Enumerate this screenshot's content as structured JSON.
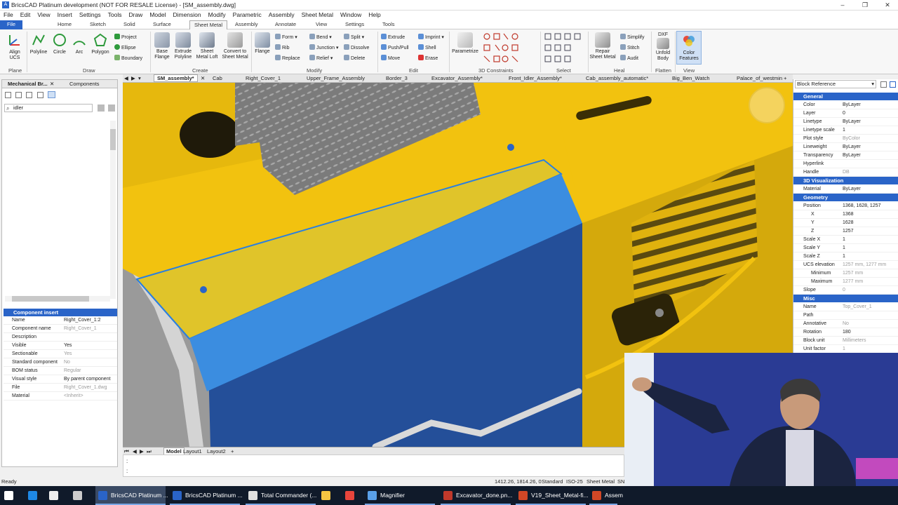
{
  "window": {
    "title": "BricsCAD Platinum development (NOT FOR RESALE License) - [SM_assembly.dwg]",
    "logo": "A"
  },
  "menu": [
    "File",
    "Edit",
    "View",
    "Insert",
    "Settings",
    "Tools",
    "Draw",
    "Model",
    "Dimension",
    "Modify",
    "Parametric",
    "Assembly",
    "Sheet Metal",
    "Window",
    "Help"
  ],
  "ribbon_tabs": [
    "File",
    "Home",
    "Sketch",
    "Solid",
    "Surface",
    "Sheet Metal",
    "Assembly",
    "Annotate",
    "View",
    "Settings",
    "Tools"
  ],
  "ribbon": {
    "plane": {
      "align_ucs": "Align UCS",
      "group": "Plane"
    },
    "draw": {
      "polyline": "Polyline",
      "circle": "Circle",
      "arc": "Arc",
      "polygon": "Polygon",
      "project": "Project",
      "ellipse": "Ellipse",
      "boundary": "Boundary",
      "group": "Draw"
    },
    "create": {
      "base_flange": "Base Flange",
      "extrude_polyline": "Extrude Polyline",
      "sheet_metal_loft": "Sheet Metal Loft",
      "convert": "Convert to Sheet Metal",
      "group": "Create"
    },
    "modify": {
      "flange": "Flange",
      "form": "Form",
      "rib": "Rib",
      "replace": "Replace",
      "bend": "Bend",
      "junction": "Junction",
      "relief": "Relief",
      "split": "Split",
      "dissolve": "Dissolve",
      "delete": "Delete",
      "group": "Modify"
    },
    "edit": {
      "extrude": "Extrude",
      "push_pull": "Push/Pull",
      "move": "Move",
      "imprint": "Imprint",
      "shell": "Shell",
      "erase": "Erase",
      "group": "Edit"
    },
    "constraints": {
      "parametrize": "Parametrize",
      "group": "3D Constraints"
    },
    "select": {
      "group": "Select"
    },
    "heal": {
      "repair": "Repair Sheet Metal",
      "simplify": "Simplify",
      "stitch": "Stitch",
      "audit": "Audit",
      "group": "Heal"
    },
    "flatten": {
      "dxf": "DXF",
      "unfold": "Unfold Body",
      "group": "Flatten"
    },
    "view": {
      "color_features": "Color Features",
      "group": "View"
    }
  },
  "doc_tabs": [
    "SM_assembly*",
    "Cab",
    "Right_Cover_1",
    "Upper_Frame_Assembly",
    "Border_3",
    "Excavator_Assembly*",
    "Front_Idler_Assembly*",
    "Cab_assembly_automatic*",
    "Big_Ben_Watch",
    "Palace_of_westmin"
  ],
  "left_panel": {
    "tabs": [
      "Mechanical Br...",
      "Components"
    ],
    "search_value": "idler",
    "section_title": "Component insert",
    "properties": [
      {
        "k": "Name",
        "v": "Right_Cover_1:2",
        "grey": false
      },
      {
        "k": "Component name",
        "v": "Right_Cover_1",
        "grey": true
      },
      {
        "k": "Description",
        "v": "",
        "grey": false
      },
      {
        "k": "Visible",
        "v": "Yes",
        "grey": false
      },
      {
        "k": "Sectionable",
        "v": "Yes",
        "grey": true
      },
      {
        "k": "Standard component",
        "v": "No",
        "grey": true
      },
      {
        "k": "BOM status",
        "v": "Regular",
        "grey": true
      },
      {
        "k": "Visual style",
        "v": "By parent component",
        "grey": false
      },
      {
        "k": "File",
        "v": "Right_Cover_1.dwg",
        "grey": true
      },
      {
        "k": "Material",
        "v": "<Inherit>",
        "grey": true
      }
    ]
  },
  "right_panel": {
    "selector": "Block Reference",
    "sections": {
      "general": "General",
      "visualization": "3D Visualization",
      "geometry": "Geometry",
      "misc": "Misc"
    },
    "general": [
      {
        "k": "Color",
        "v": "ByLayer"
      },
      {
        "k": "Layer",
        "v": "0"
      },
      {
        "k": "Linetype",
        "v": "ByLayer"
      },
      {
        "k": "Linetype scale",
        "v": "1"
      },
      {
        "k": "Plot style",
        "v": "ByColor"
      },
      {
        "k": "Lineweight",
        "v": "ByLayer"
      },
      {
        "k": "Transparency",
        "v": "ByLayer"
      },
      {
        "k": "Hyperlink",
        "v": ""
      },
      {
        "k": "Handle",
        "v": "DB"
      }
    ],
    "material": {
      "k": "Material",
      "v": "ByLayer"
    },
    "geometry": [
      {
        "k": "Position",
        "v": "1368, 1628, 1257",
        "sub": false
      },
      {
        "k": "X",
        "v": "1368",
        "sub": true
      },
      {
        "k": "Y",
        "v": "1628",
        "sub": true
      },
      {
        "k": "Z",
        "v": "1257",
        "sub": true
      },
      {
        "k": "Scale X",
        "v": "1",
        "sub": false
      },
      {
        "k": "Scale Y",
        "v": "1",
        "sub": false
      },
      {
        "k": "Scale Z",
        "v": "1",
        "sub": false
      },
      {
        "k": "UCS elevation",
        "v": "1257 mm, 1277 mm",
        "sub": false
      },
      {
        "k": "Minimum",
        "v": "1257 mm",
        "sub": true
      },
      {
        "k": "Maximum",
        "v": "1277 mm",
        "sub": true
      },
      {
        "k": "Slope",
        "v": "0",
        "sub": false
      }
    ],
    "misc": [
      {
        "k": "Name",
        "v": "Top_Cover_1"
      },
      {
        "k": "Path",
        "v": ""
      },
      {
        "k": "Annotative",
        "v": "No"
      },
      {
        "k": "Rotation",
        "v": "180"
      },
      {
        "k": "Block unit",
        "v": "Millimeters"
      },
      {
        "k": "Unit factor",
        "v": "1"
      }
    ]
  },
  "layout_tabs": [
    "Model",
    "Layout1",
    "Layout2",
    "+"
  ],
  "status": {
    "left": "Ready",
    "coords": "1412.26, 1814.26, 0",
    "standard": "Standard",
    "iso": "ISO-25",
    "workspace": "Sheet Metal",
    "sn": "SN"
  },
  "taskbar": [
    {
      "label": "",
      "color": "#ffffff",
      "icon": "windows-icon"
    },
    {
      "label": "",
      "color": "#1e88e5",
      "icon": "edge-icon"
    },
    {
      "label": "",
      "color": "#cccccc",
      "icon": "mail-icon"
    },
    {
      "label": "",
      "color": "#eeeeee",
      "icon": "calendar-icon"
    },
    {
      "label": "BricsCAD Platinum ...",
      "color": "#2a64c8",
      "icon": "bricscad-icon"
    },
    {
      "label": "BricsCAD Platinum ...",
      "color": "#2a64c8",
      "icon": "bricscad-icon"
    },
    {
      "label": "Total Commander (...",
      "color": "#e0e0e0",
      "icon": "total-commander-icon"
    },
    {
      "label": "",
      "color": "#f5c542",
      "icon": "folder-icon"
    },
    {
      "label": "",
      "color": "#e8453c",
      "icon": "chrome-icon"
    },
    {
      "label": "Magnifier",
      "color": "#5aa0e8",
      "icon": "magnifier-icon"
    },
    {
      "label": "Excavator_done.pn...",
      "color": "#c0392b",
      "icon": "image-icon"
    },
    {
      "label": "V19_Sheet_Metal-fi...",
      "color": "#d24726",
      "icon": "powerpoint-icon"
    },
    {
      "label": "Assem",
      "color": "#d24726",
      "icon": "powerpoint-icon"
    }
  ],
  "colors": {
    "accent": "#2a64c8",
    "yellow": "#f2c20f",
    "selected_blue": "#3b8de0",
    "taskbar": "#101a2a"
  }
}
